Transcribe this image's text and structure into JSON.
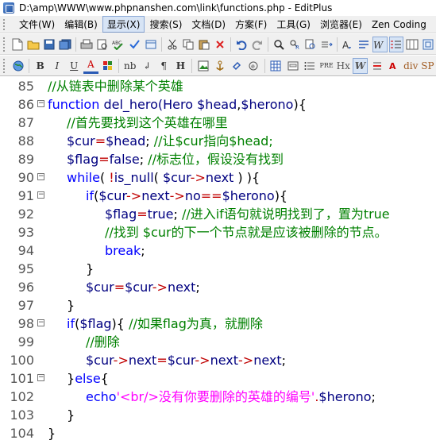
{
  "window": {
    "title": "D:\\amp\\WWW\\www.phpnanshen.com\\link\\functions.php - EditPlus"
  },
  "menu": [
    {
      "label": "文件(W)",
      "active": false
    },
    {
      "label": "编辑(B)",
      "active": false
    },
    {
      "label": "显示(X)",
      "active": true
    },
    {
      "label": "搜索(S)",
      "active": false
    },
    {
      "label": "文档(D)",
      "active": false
    },
    {
      "label": "方案(F)",
      "active": false
    },
    {
      "label": "工具(G)",
      "active": false
    },
    {
      "label": "浏览器(E)",
      "active": false
    },
    {
      "label": "Zen Coding",
      "active": false
    }
  ],
  "toolbar2_text": {
    "bold": "B",
    "italic": "I",
    "underline": "U",
    "font_color": "A",
    "nbsp": "nb",
    "pilcrow": "¶",
    "heading": "H",
    "pre": "PRE",
    "hx": "Hx",
    "w": "W",
    "div": "div",
    "span": "SP"
  },
  "code_lines": [
    {
      "num": "85",
      "fold": "",
      "indent": 0,
      "tokens": [
        [
          "c",
          "//从链表中删除某个英雄"
        ]
      ]
    },
    {
      "num": "86",
      "fold": "⊟",
      "indent": 0,
      "tokens": [
        [
          "k",
          "function "
        ],
        [
          "d",
          "del_hero(Hero "
        ],
        [
          "v",
          "$head"
        ],
        [
          "n",
          ","
        ],
        [
          "v",
          "$herono"
        ],
        [
          "n",
          "){"
        ]
      ]
    },
    {
      "num": "87",
      "fold": "",
      "indent": 1,
      "tokens": [
        [
          "c",
          "//首先要找到这个英雄在哪里"
        ]
      ]
    },
    {
      "num": "88",
      "fold": "",
      "indent": 1,
      "tokens": [
        [
          "v",
          "$cur"
        ],
        [
          "o",
          "="
        ],
        [
          "v",
          "$head"
        ],
        [
          "n",
          "; "
        ],
        [
          "c",
          "//让$cur指向$head;"
        ]
      ]
    },
    {
      "num": "89",
      "fold": "",
      "indent": 1,
      "tokens": [
        [
          "v",
          "$flag"
        ],
        [
          "o",
          "="
        ],
        [
          "d",
          "false"
        ],
        [
          "n",
          "; "
        ],
        [
          "c",
          "//标志位，假设没有找到"
        ]
      ]
    },
    {
      "num": "90",
      "fold": "⊟",
      "indent": 1,
      "tokens": [
        [
          "k",
          "while"
        ],
        [
          "n",
          "( "
        ],
        [
          "o",
          "!"
        ],
        [
          "d",
          "is_null"
        ],
        [
          "n",
          "( "
        ],
        [
          "v",
          "$cur"
        ],
        [
          "o",
          "->"
        ],
        [
          "d",
          "next"
        ],
        [
          "n",
          " ) ){"
        ]
      ]
    },
    {
      "num": "91",
      "fold": "⊟",
      "indent": 2,
      "tokens": [
        [
          "k",
          "if"
        ],
        [
          "n",
          "("
        ],
        [
          "v",
          "$cur"
        ],
        [
          "o",
          "->"
        ],
        [
          "d",
          "next"
        ],
        [
          "o",
          "->"
        ],
        [
          "d",
          "no"
        ],
        [
          "o",
          "=="
        ],
        [
          "v",
          "$herono"
        ],
        [
          "n",
          "){"
        ]
      ]
    },
    {
      "num": "92",
      "fold": "",
      "indent": 3,
      "tokens": [
        [
          "v",
          "$flag"
        ],
        [
          "o",
          "="
        ],
        [
          "d",
          "true"
        ],
        [
          "n",
          "; "
        ],
        [
          "c",
          "//进入if语句就说明找到了，置为true"
        ]
      ]
    },
    {
      "num": "93",
      "fold": "",
      "indent": 3,
      "tokens": [
        [
          "c",
          "//找到 $cur的下一个节点就是应该被删除的节点。"
        ]
      ]
    },
    {
      "num": "94",
      "fold": "",
      "indent": 3,
      "tokens": [
        [
          "k",
          "break"
        ],
        [
          "n",
          ";"
        ]
      ]
    },
    {
      "num": "95",
      "fold": "",
      "indent": 2,
      "tokens": [
        [
          "n",
          "}"
        ]
      ]
    },
    {
      "num": "96",
      "fold": "",
      "indent": 2,
      "tokens": [
        [
          "v",
          "$cur"
        ],
        [
          "o",
          "="
        ],
        [
          "v",
          "$cur"
        ],
        [
          "o",
          "->"
        ],
        [
          "d",
          "next"
        ],
        [
          "n",
          ";"
        ]
      ]
    },
    {
      "num": "97",
      "fold": "",
      "indent": 1,
      "tokens": [
        [
          "n",
          "}"
        ]
      ]
    },
    {
      "num": "98",
      "fold": "⊟",
      "indent": 1,
      "tokens": [
        [
          "k",
          "if"
        ],
        [
          "n",
          "("
        ],
        [
          "v",
          "$flag"
        ],
        [
          "n",
          "){ "
        ],
        [
          "c",
          "//如果flag为真，就删除"
        ]
      ]
    },
    {
      "num": "99",
      "fold": "",
      "indent": 2,
      "tokens": [
        [
          "c",
          "//删除"
        ]
      ]
    },
    {
      "num": "100",
      "fold": "",
      "indent": 2,
      "tokens": [
        [
          "v",
          "$cur"
        ],
        [
          "o",
          "->"
        ],
        [
          "d",
          "next"
        ],
        [
          "o",
          "="
        ],
        [
          "v",
          "$cur"
        ],
        [
          "o",
          "->"
        ],
        [
          "d",
          "next"
        ],
        [
          "o",
          "->"
        ],
        [
          "d",
          "next"
        ],
        [
          "n",
          ";"
        ]
      ]
    },
    {
      "num": "101",
      "fold": "⊟",
      "indent": 1,
      "tokens": [
        [
          "n",
          "}"
        ],
        [
          "k",
          "else"
        ],
        [
          "n",
          "{"
        ]
      ]
    },
    {
      "num": "102",
      "fold": "",
      "indent": 2,
      "tokens": [
        [
          "k",
          "echo"
        ],
        [
          "s",
          "'<br/>没有你要删除的英雄的编号'"
        ],
        [
          "o",
          "."
        ],
        [
          "v",
          "$herono"
        ],
        [
          "n",
          ";"
        ]
      ]
    },
    {
      "num": "103",
      "fold": "",
      "indent": 1,
      "tokens": [
        [
          "n",
          "}"
        ]
      ]
    },
    {
      "num": "104",
      "fold": "",
      "indent": 0,
      "tokens": [
        [
          "n",
          "}"
        ]
      ]
    }
  ],
  "colors": {
    "comment": "#008000",
    "keyword": "#0000ff",
    "variable": "#000080",
    "operator": "#c00000",
    "string": "#ff00ff"
  }
}
